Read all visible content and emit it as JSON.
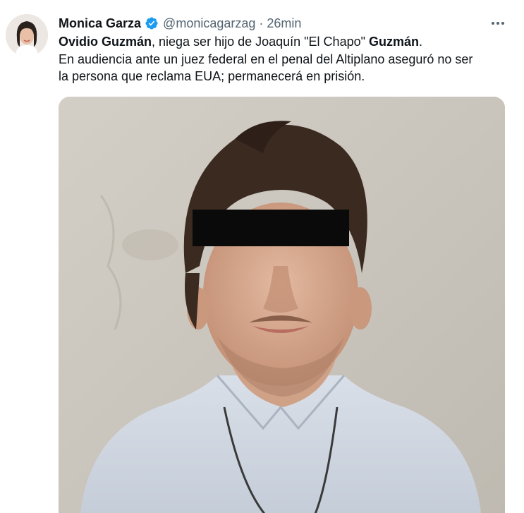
{
  "tweet": {
    "author_name": "Monica Garza",
    "handle": "@monicagarzag",
    "separator": "·",
    "timestamp": "26min",
    "verified": true,
    "more_icon": "more-horizontal-icon",
    "verified_icon": "verified-badge-icon",
    "accent_color": "#1d9bf0",
    "text": {
      "line1_bold_a": "Ovidio Guzmán",
      "line1_mid": ", niega ser hijo de Joaquín \"El Chapo\" ",
      "line1_bold_b": "Guzmán",
      "line1_end": ".",
      "line2": "En audiencia ante un juez federal en el penal del Altiplano aseguró no ser",
      "line3": "la persona que reclama EUA; permanecerá en prisión."
    },
    "media": {
      "kind": "photo",
      "subject": "man with black censor bar over eyes"
    }
  }
}
